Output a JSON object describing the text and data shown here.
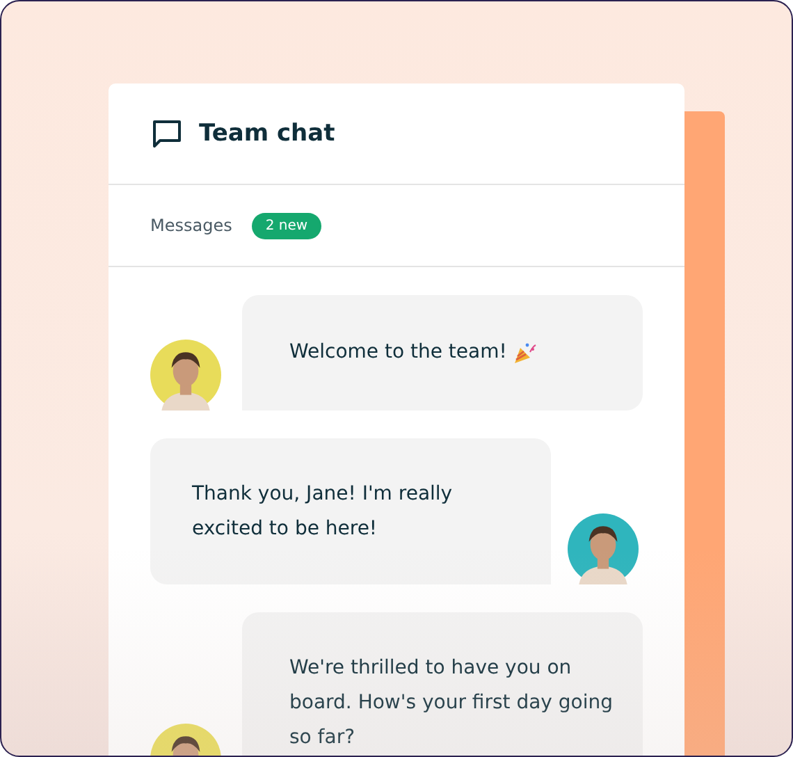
{
  "chat": {
    "title": "Team chat",
    "section_label": "Messages",
    "new_badge": "2 new"
  },
  "messages": [
    {
      "kind": "received",
      "text": "Welcome to the team!",
      "party_popper": true
    },
    {
      "kind": "sent",
      "text": "Thank you, Jane! I'm really excited to be here!",
      "party_popper": false
    },
    {
      "kind": "received",
      "text": "We're thrilled to have you on board. How's your first day going so far?",
      "party_popper": false
    }
  ]
}
